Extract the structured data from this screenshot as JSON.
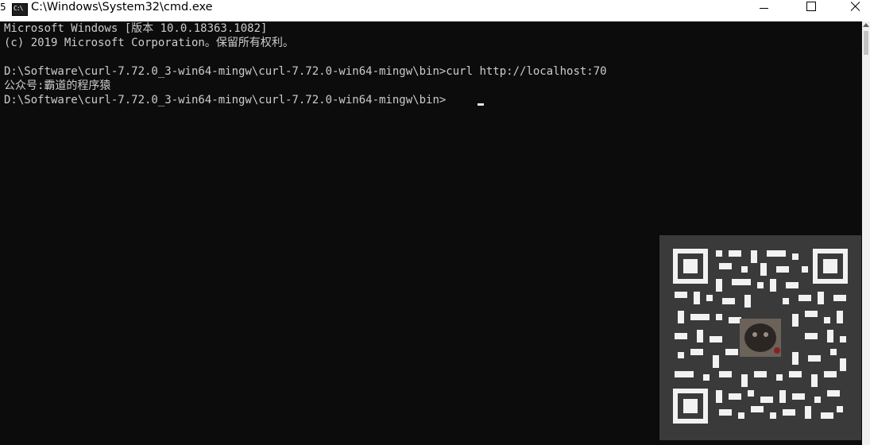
{
  "window": {
    "title": "C:\\Windows\\System32\\cmd.exe",
    "icon": "cmd-console-icon",
    "icon_text": "C:\\",
    "edge_glyph": "5",
    "controls": [
      "minimize-icon",
      "maximize-icon",
      "close-icon"
    ]
  },
  "console": {
    "lines": [
      "Microsoft Windows [版本 10.0.18363.1082]",
      "(c) 2019 Microsoft Corporation。保留所有权利。",
      "",
      "D:\\Software\\curl-7.72.0_3-win64-mingw\\curl-7.72.0-win64-mingw\\bin>curl http://localhost:70",
      "公众号:霸道的程序猿",
      "D:\\Software\\curl-7.72.0_3-win64-mingw\\curl-7.72.0-win64-mingw\\bin>"
    ],
    "foreground": "#cccccc",
    "background": "#0c0c0c"
  },
  "overlay": {
    "qr_code": "qr-code-icon"
  }
}
